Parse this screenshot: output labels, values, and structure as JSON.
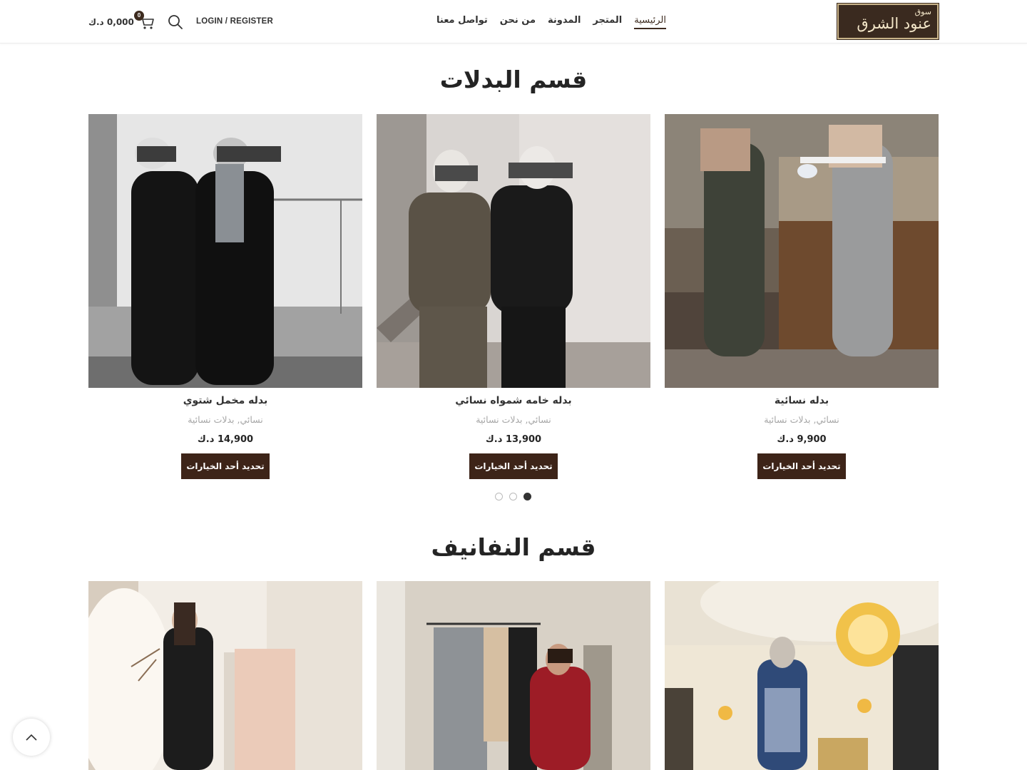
{
  "brand": {
    "small": "سوق",
    "name": "عنود الشرق"
  },
  "nav": {
    "items": [
      {
        "label": "الرئيسية",
        "active": true
      },
      {
        "label": "المتجر"
      },
      {
        "label": "المدونة"
      },
      {
        "label": "من نحن"
      },
      {
        "label": "تواصل معنا"
      }
    ],
    "login_label": "LOGIN / REGISTER",
    "cart_count": "0",
    "cart_total": "0,000 د.ك"
  },
  "sections": [
    {
      "title": "قسم البدلات",
      "products": [
        {
          "name": "بدله نسائية",
          "categories": "نسائي, بدلات نسائية",
          "price": "9,900 د.ك",
          "button": "تحديد أحد الخيارات"
        },
        {
          "name": "بدله خامه شمواه نسائي",
          "categories": "نسائي, بدلات نسائية",
          "price": "13,900 د.ك",
          "button": "تحديد أحد الخيارات"
        },
        {
          "name": "بدله مخمل شتوي",
          "categories": "نسائي, بدلات نسائية",
          "price": "14,900 د.ك",
          "button": "تحديد أحد الخيارات"
        }
      ],
      "carousel": {
        "pages": 3,
        "active_page": 1
      }
    },
    {
      "title": "قسم النفانيف",
      "products": []
    }
  ],
  "colors": {
    "accent": "#3d2418",
    "text": "#333333",
    "muted": "#a5a5a5"
  }
}
